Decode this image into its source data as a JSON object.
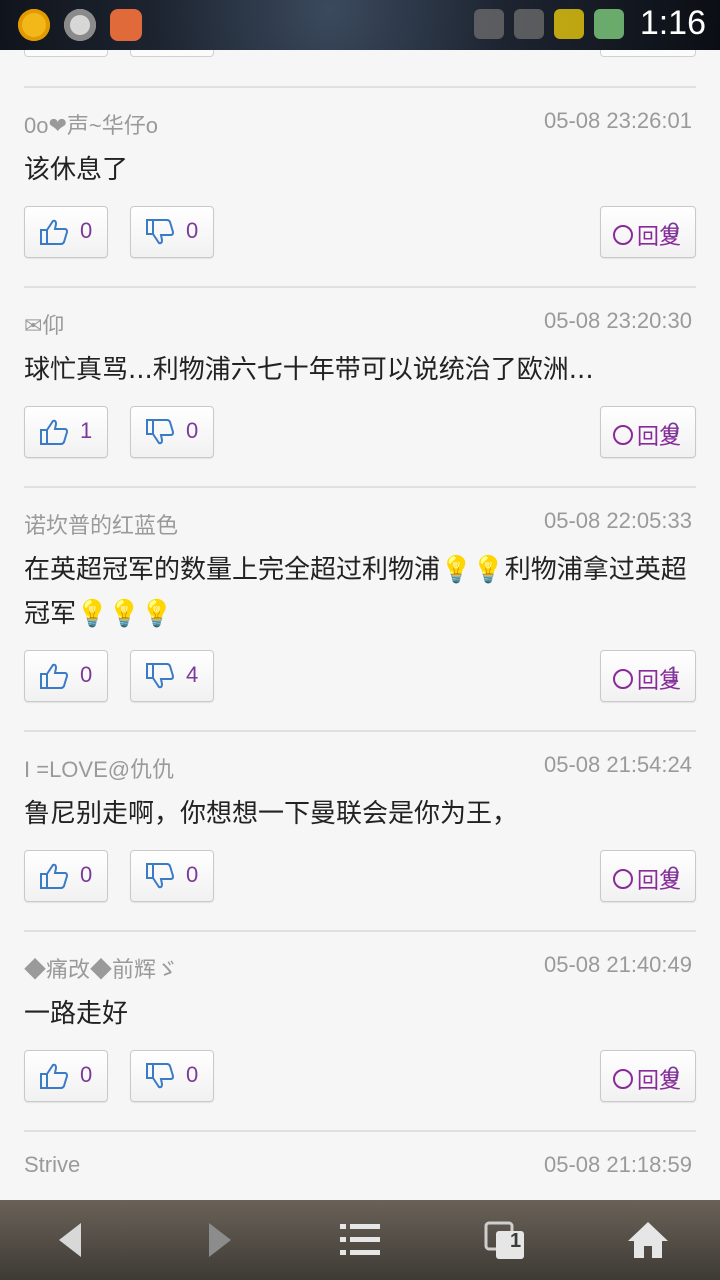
{
  "status_bar": {
    "time": "1:16"
  },
  "comments": [
    {
      "user": "0o❤声~华仔o",
      "time": "05-08 23:26:01",
      "text": "该休息了",
      "likes": "0",
      "dislikes": "0",
      "reply_label": "回复",
      "replies": "0"
    },
    {
      "user": "✉仰",
      "time": "05-08 23:20:30",
      "text": "球忙真骂...利物浦六七十年带可以说统治了欧洲...",
      "likes": "1",
      "dislikes": "0",
      "reply_label": "回复",
      "replies": "0"
    },
    {
      "user": "诺坎普的红蓝色",
      "time": "05-08 22:05:33",
      "text": "在英超冠军的数量上完全超过利物浦💡💡利物浦拿过英超冠军💡💡💡",
      "likes": "0",
      "dislikes": "4",
      "reply_label": "回复",
      "replies": "1"
    },
    {
      "user": "I =LOVE@仇仇",
      "time": "05-08 21:54:24",
      "text": "鲁尼别走啊，你想想一下曼联会是你为王，",
      "likes": "0",
      "dislikes": "0",
      "reply_label": "回复",
      "replies": "0"
    },
    {
      "user": "◆痛改◆前辉ゞ",
      "time": "05-08 21:40:49",
      "text": "一路走好",
      "likes": "0",
      "dislikes": "0",
      "reply_label": "回复",
      "replies": "0"
    },
    {
      "user": "Strive",
      "time": "05-08 21:18:59",
      "text": "",
      "likes": "",
      "dislikes": "",
      "reply_label": "",
      "replies": ""
    }
  ],
  "bottom_nav": {
    "tabs_count": "1"
  },
  "colors": {
    "accent": "#8a2a9a",
    "thumb": "#3a7bc8",
    "meta": "#9a9a9a"
  }
}
